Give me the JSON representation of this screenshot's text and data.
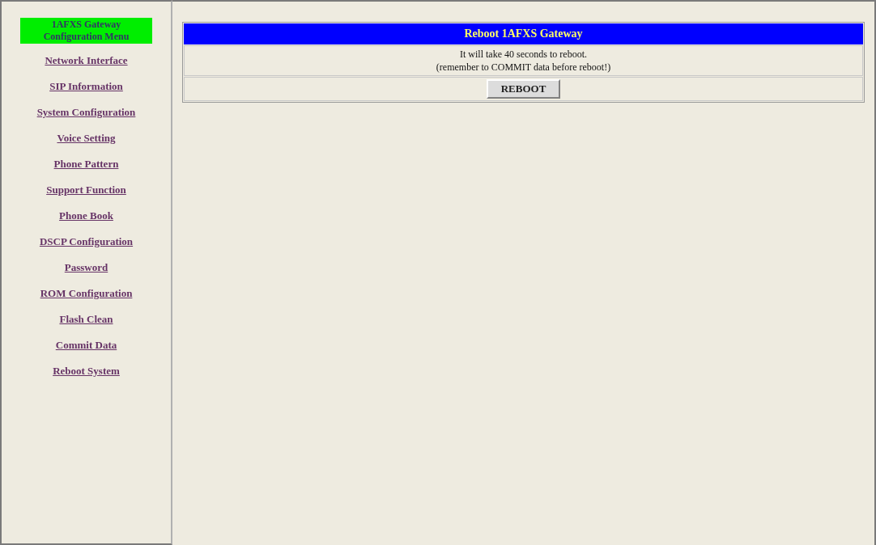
{
  "sidebar": {
    "title": "1AFXS Gateway Configuration Menu",
    "items": [
      {
        "label": "Network Interface"
      },
      {
        "label": "SIP Information"
      },
      {
        "label": "System Configuration"
      },
      {
        "label": "Voice Setting"
      },
      {
        "label": "Phone Pattern"
      },
      {
        "label": "Support Function"
      },
      {
        "label": "Phone Book"
      },
      {
        "label": "DSCP Configuration"
      },
      {
        "label": "Password"
      },
      {
        "label": "ROM Configuration"
      },
      {
        "label": "Flash Clean"
      },
      {
        "label": "Commit Data"
      },
      {
        "label": "Reboot System"
      }
    ]
  },
  "panel": {
    "title": "Reboot 1AFXS Gateway",
    "lines": [
      "It will take 40 seconds to reboot.",
      "(remember to COMMIT data before reboot!)"
    ],
    "button": "REBOOT"
  }
}
